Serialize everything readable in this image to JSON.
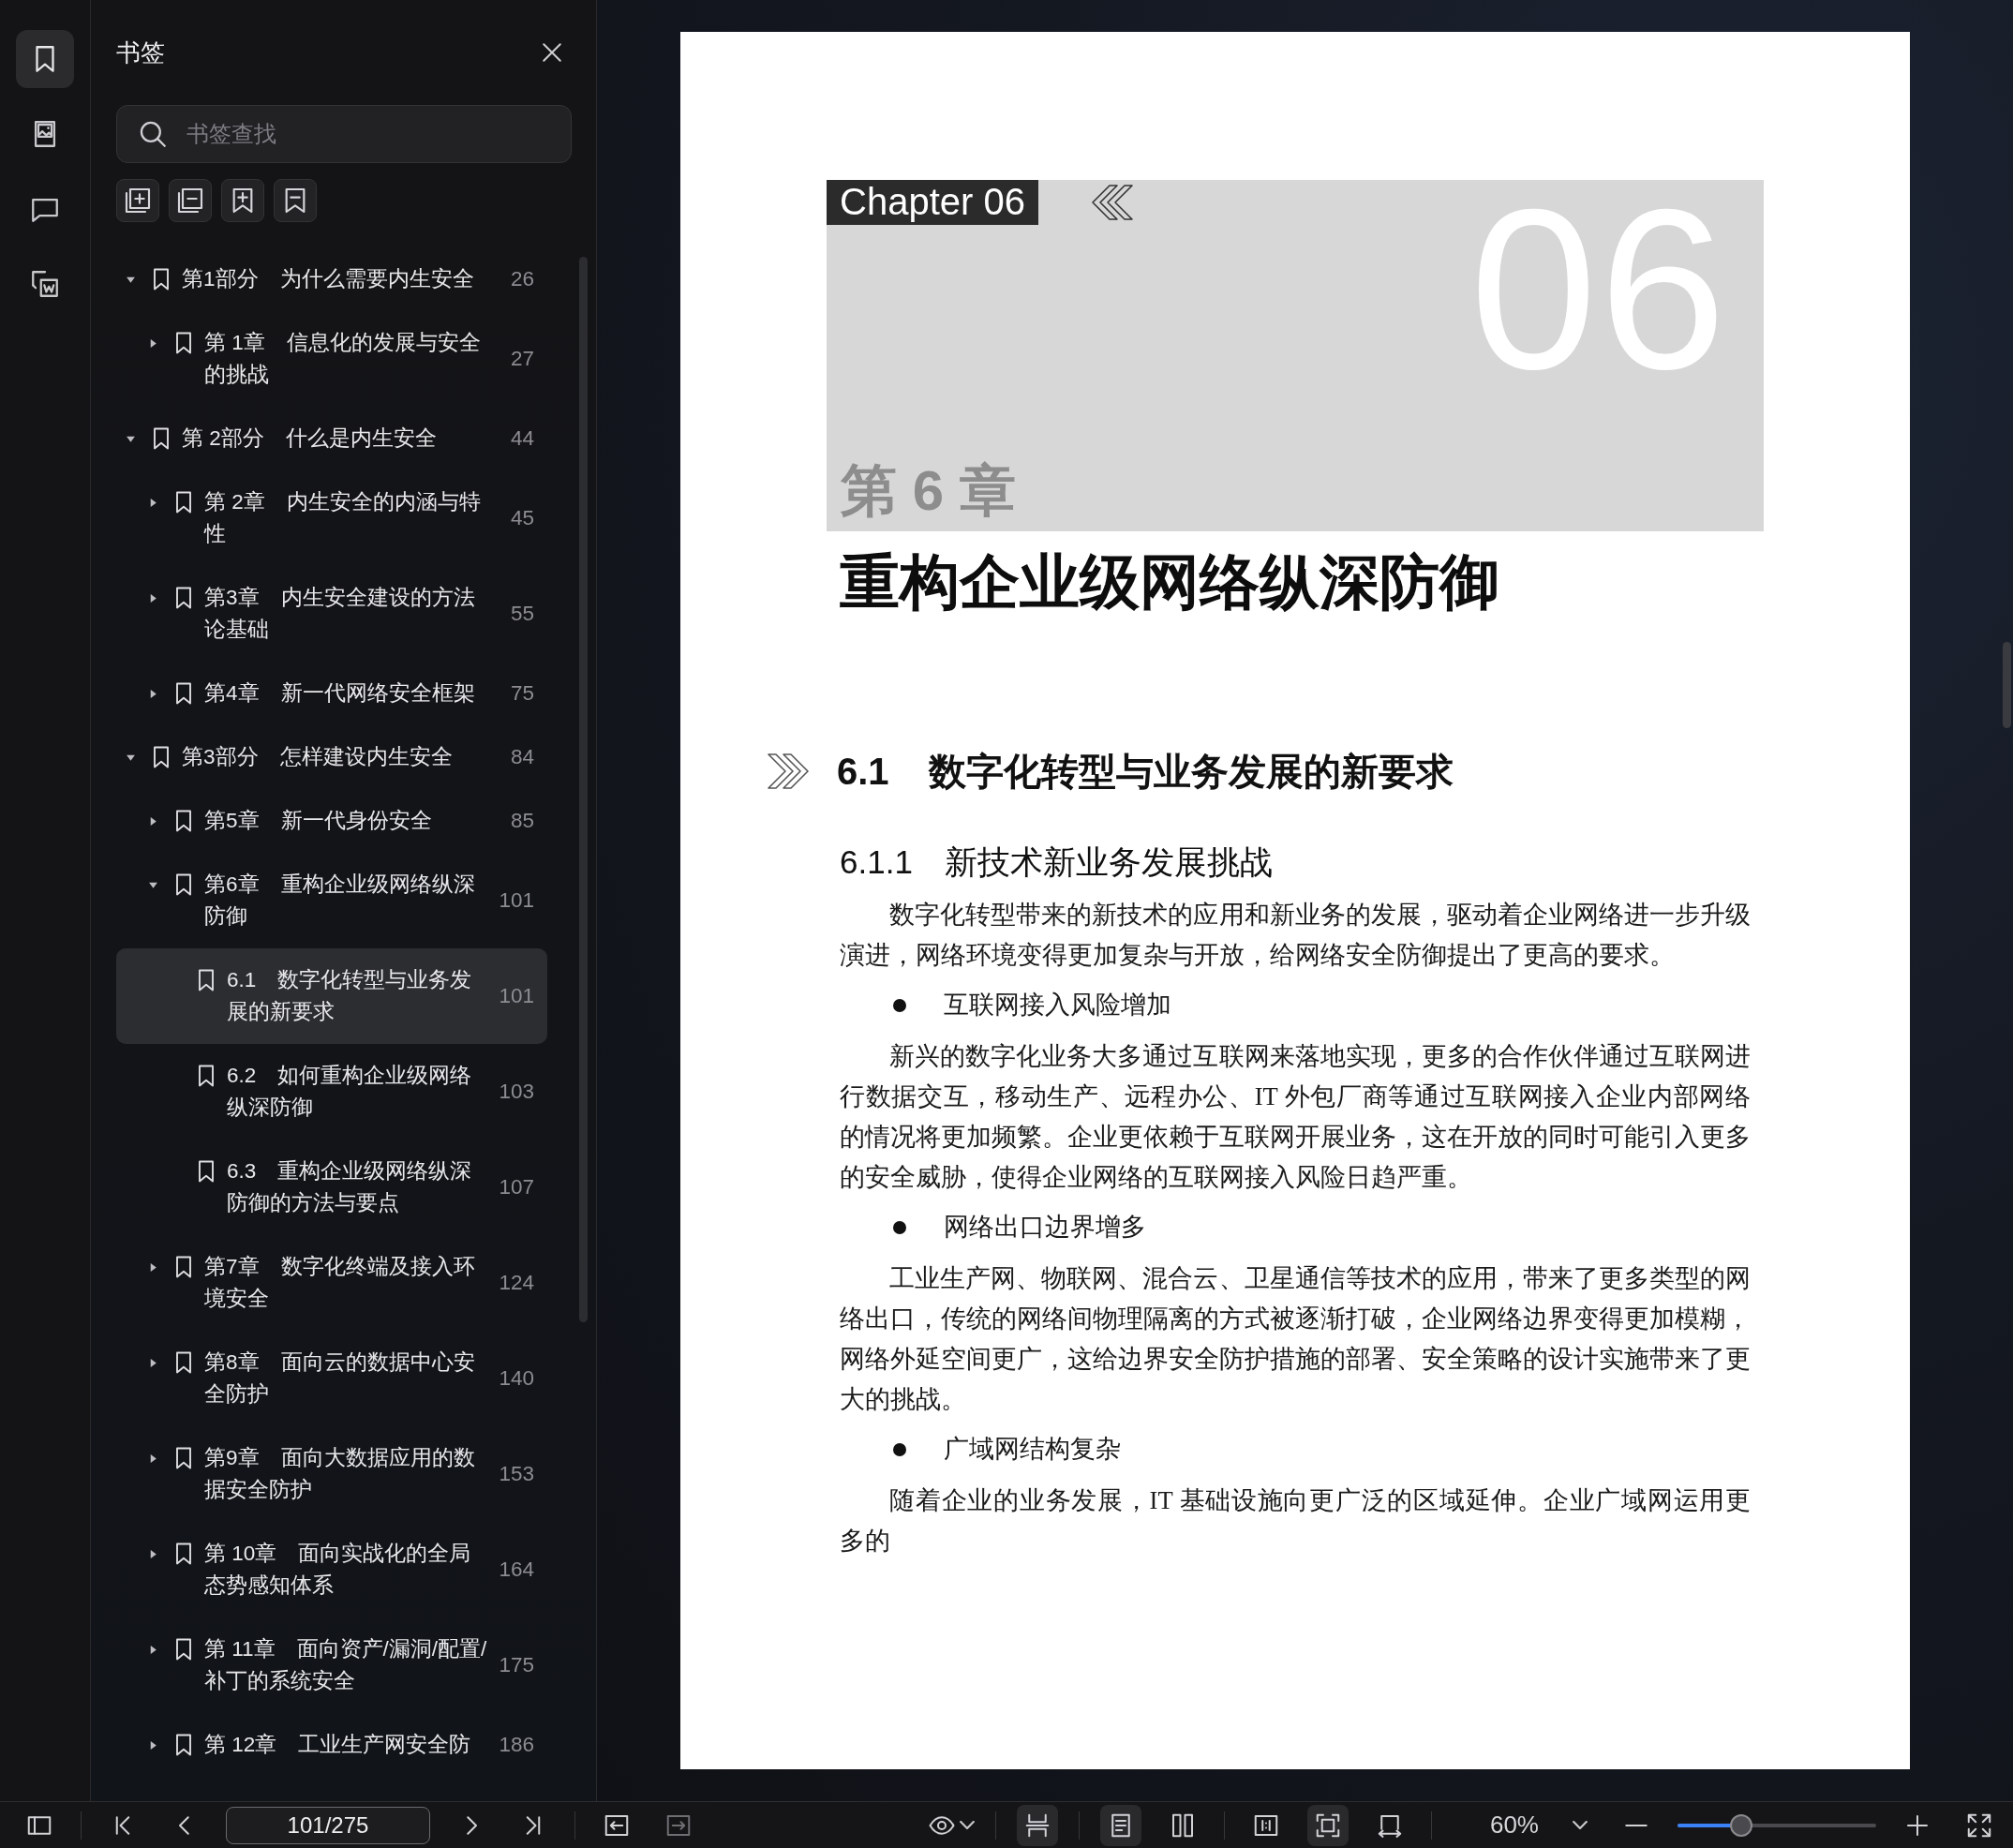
{
  "rail": [
    {
      "kind": "bookmarks",
      "selected": true
    },
    {
      "kind": "thumbnails",
      "selected": false
    },
    {
      "kind": "comments",
      "selected": false
    },
    {
      "kind": "convert",
      "selected": false
    }
  ],
  "bookmarks_panel": {
    "title": "书签",
    "search": {
      "placeholder": "书签查找"
    },
    "tools": [
      {
        "kind": "expand-all"
      },
      {
        "kind": "collapse-all"
      },
      {
        "kind": "add-bookmark"
      },
      {
        "kind": "remove-bookmark"
      }
    ],
    "items": [
      {
        "label": "第1部分　为什么需要内生安全",
        "page": "26",
        "expanded": true,
        "selected": false,
        "children": [
          {
            "label": "第 1章　信息化的发展与安全的挑战",
            "page": "27",
            "expanded": false,
            "selected": false
          }
        ]
      },
      {
        "label": "第 2部分　什么是内生安全",
        "page": "44",
        "expanded": true,
        "selected": false,
        "children": [
          {
            "label": "第 2章　内生安全的内涵与特性",
            "page": "45",
            "expanded": false,
            "selected": false
          },
          {
            "label": "第3章　内生安全建设的方法论基础",
            "page": "55",
            "expanded": false,
            "selected": false
          },
          {
            "label": "第4章　新一代网络安全框架",
            "page": "75",
            "expanded": false,
            "selected": false
          }
        ]
      },
      {
        "label": "第3部分　怎样建设内生安全",
        "page": "84",
        "expanded": true,
        "selected": false,
        "children": [
          {
            "label": "第5章　新一代身份安全",
            "page": "85",
            "expanded": false,
            "selected": false
          },
          {
            "label": "第6章　重构企业级网络纵深防御",
            "page": "101",
            "expanded": true,
            "selected": false,
            "children": [
              {
                "label": "6.1　数字化转型与业务发展的新要求",
                "page": "101",
                "selected": true
              },
              {
                "label": "6.2　如何重构企业级网络纵深防御",
                "page": "103",
                "selected": false
              },
              {
                "label": "6.3　重构企业级网络纵深防御的方法与要点",
                "page": "107",
                "selected": false
              }
            ]
          },
          {
            "label": "第7章　数字化终端及接入环境安全",
            "page": "124",
            "expanded": false,
            "selected": false
          },
          {
            "label": "第8章　面向云的数据中心安全防护",
            "page": "140",
            "expanded": false,
            "selected": false
          },
          {
            "label": "第9章　面向大数据应用的数据安全防护",
            "page": "153",
            "expanded": false,
            "selected": false
          },
          {
            "label": "第 10章　面向实战化的全局态势感知体系",
            "page": "164",
            "expanded": false,
            "selected": false
          },
          {
            "label": "第 11章　面向资产/漏洞/配置/补丁的系统安全",
            "page": "175",
            "expanded": false,
            "selected": false
          },
          {
            "label": "第 12章　工业生产网安全防",
            "page": "186",
            "expanded": false,
            "selected": false
          }
        ]
      }
    ]
  },
  "page": {
    "chapter_label": "Chapter 06",
    "chapter_number": "06",
    "chapter_cn": "第 6 章",
    "chapter_title": "重构企业级网络纵深防御",
    "blocks": [
      {
        "kind": "h1",
        "number": "6.1",
        "text": "数字化转型与业务发展的新要求"
      },
      {
        "kind": "h2",
        "number": "6.1.1",
        "text": "新技术新业务发展挑战"
      },
      {
        "kind": "p",
        "text": "数字化转型带来的新技术的应用和新业务的发展，驱动着企业网络进一步升级演进，网络环境变得更加复杂与开放，给网络安全防御提出了更高的要求。"
      },
      {
        "kind": "bullet",
        "text": "互联网接入风险增加"
      },
      {
        "kind": "p",
        "text": "新兴的数字化业务大多通过互联网来落地实现，更多的合作伙伴通过互联网进行数据交互，移动生产、远程办公、IT 外包厂商等通过互联网接入企业内部网络的情况将更加频繁。企业更依赖于互联网开展业务，这在开放的同时可能引入更多的安全威胁，使得企业网络的互联网接入风险日趋严重。"
      },
      {
        "kind": "bullet",
        "text": "网络出口边界增多"
      },
      {
        "kind": "p",
        "text": "工业生产网、物联网、混合云、卫星通信等技术的应用，带来了更多类型的网络出口，传统的网络间物理隔离的方式被逐渐打破，企业网络边界变得更加模糊，网络外延空间更广，这给边界安全防护措施的部署、安全策略的设计实施带来了更大的挑战。"
      },
      {
        "kind": "bullet",
        "text": "广域网结构复杂"
      },
      {
        "kind": "p",
        "text": "随着企业的业务发展，IT 基础设施向更广泛的区域延伸。企业广域网运用更多的"
      }
    ]
  },
  "toolbar": {
    "nav": [
      {
        "kind": "first",
        "disabled": false
      },
      {
        "kind": "prev",
        "disabled": false
      }
    ],
    "page_field": {
      "value": "101/275"
    },
    "nav_after": [
      {
        "kind": "next",
        "disabled": false
      },
      {
        "kind": "last",
        "disabled": false
      }
    ],
    "history": [
      {
        "kind": "back",
        "disabled": false
      },
      {
        "kind": "forward",
        "disabled": true
      }
    ],
    "view_groups": [
      [
        {
          "kind": "continuous",
          "selected": true
        }
      ],
      [
        {
          "kind": "single-page",
          "selected": true
        },
        {
          "kind": "two-page",
          "selected": false
        }
      ],
      [
        {
          "kind": "actual-size",
          "selected": false
        },
        {
          "kind": "fit-page",
          "selected": true
        },
        {
          "kind": "fit-width",
          "selected": false
        }
      ]
    ],
    "zoom": {
      "value": "60%",
      "level": 0.32
    }
  }
}
